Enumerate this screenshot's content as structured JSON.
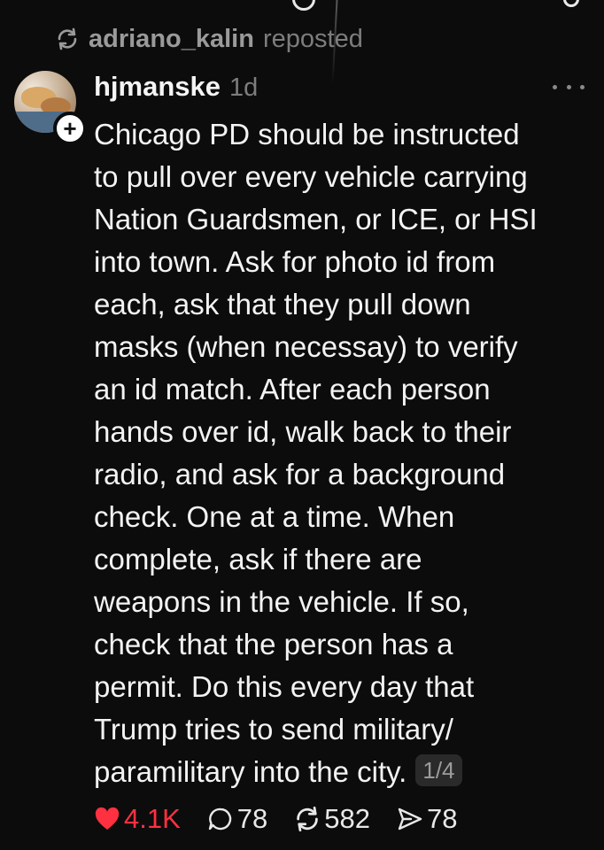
{
  "repost": {
    "username": "adriano_kalin",
    "verb": "reposted"
  },
  "post": {
    "username": "hjmanske",
    "time": "1d",
    "lines": [
      "Chicago PD should be instructed",
      "to pull over every vehicle carrying",
      "Nation Guardsmen, or ICE, or HSI",
      "into town. Ask for photo id from",
      "each, ask that they pull down",
      "masks (when necessay) to verify",
      "an id match. After each person",
      "hands over id, walk back to their",
      "radio, and ask for a background",
      "check. One at a time. When",
      "complete, ask if there are",
      "weapons in the vehicle. If so,",
      "check that the person has a",
      "permit. Do this every day that",
      "Trump tries to send military/",
      "paramilitary into the city."
    ],
    "page_indicator": "1/4"
  },
  "actions": {
    "likes": "4.1K",
    "replies": "78",
    "reposts": "582",
    "shares": "78"
  },
  "icons": {
    "repost_header": "repost-icon",
    "avatar_badge": "plus-icon",
    "more": "more-dots-icon",
    "like": "heart-icon",
    "reply": "comment-bubble-icon",
    "repost": "repost-icon",
    "share": "send-icon"
  },
  "colors": {
    "background": "#0c0c0c",
    "text": "#f3f3f3",
    "muted": "#7d7d7d",
    "like": "#ff3040"
  }
}
